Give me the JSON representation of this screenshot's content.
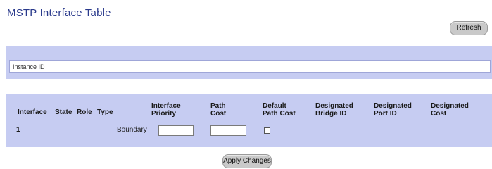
{
  "page": {
    "title": "MSTP Interface Table"
  },
  "toolbar": {
    "refresh_label": "Refresh"
  },
  "filter": {
    "label": "Instance ID"
  },
  "table": {
    "headers": {
      "interface": "Interface",
      "state": "State",
      "role": "Role",
      "type": "Type",
      "interface_priority": [
        "Interface",
        "Priority"
      ],
      "path_cost": [
        "Path",
        "Cost"
      ],
      "default_path_cost": [
        "Default",
        "Path Cost"
      ],
      "designated_bridge_id": [
        "Designated",
        "Bridge ID"
      ],
      "designated_port_id": [
        "Designated",
        "Port ID"
      ],
      "designated_cost": [
        "Designated",
        "Cost"
      ]
    },
    "rows": [
      {
        "interface": "1",
        "state": "",
        "role": "",
        "type": "Boundary",
        "interface_priority": "",
        "path_cost": "",
        "default_path_cost": false,
        "designated_bridge_id": "",
        "designated_port_id": "",
        "designated_cost": ""
      }
    ]
  },
  "footer": {
    "apply_label": "Apply Changes"
  }
}
